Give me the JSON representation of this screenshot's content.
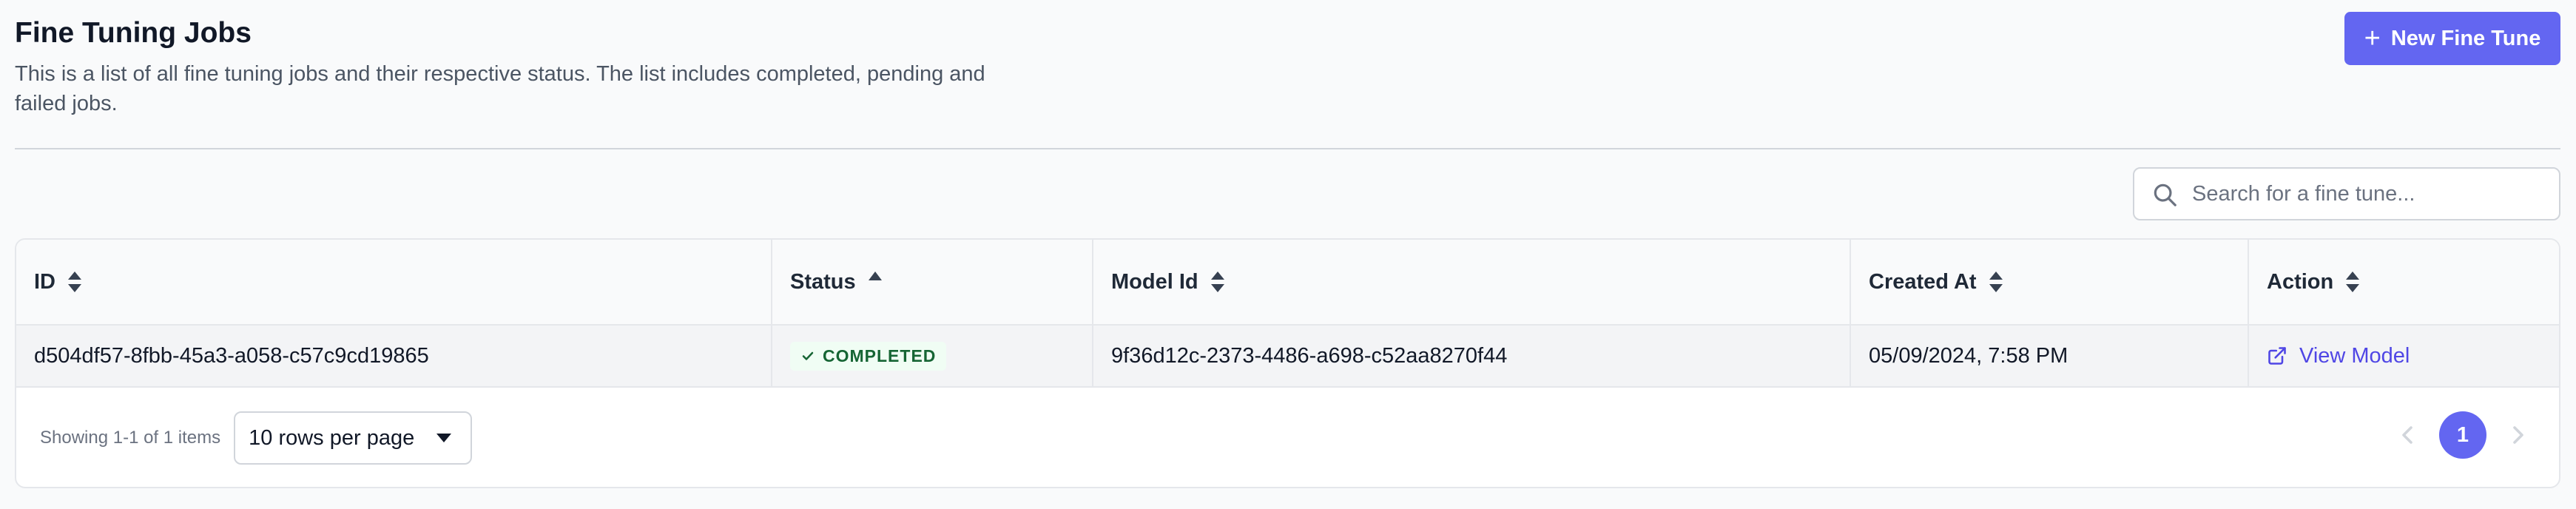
{
  "header": {
    "title": "Fine Tuning Jobs",
    "subtitle": "This is a list of all fine tuning jobs and their respective status. The list includes completed, pending and failed jobs.",
    "new_button_label": "New Fine Tune"
  },
  "search": {
    "placeholder": "Search for a fine tune...",
    "value": ""
  },
  "table": {
    "columns": [
      "ID",
      "Status",
      "Model Id",
      "Created At",
      "Action"
    ],
    "sort": {
      "column": "Status",
      "direction": "ascending"
    },
    "rows": [
      {
        "id": "d504df57-8fbb-45a3-a058-c57c9cd19865",
        "status": "COMPLETED",
        "model_id": "9f36d12c-2373-4486-a698-c52aa8270f44",
        "created_at": "05/09/2024, 7:58 PM",
        "action": "View Model"
      }
    ]
  },
  "footer": {
    "showing": "Showing 1-1 of 1 items",
    "rows_per_page": "10 rows per page",
    "current_page": "1"
  },
  "colors": {
    "accent": "#6366f1",
    "link": "#4f46e5",
    "status_success": "#166534",
    "status_success_bg": "#f0fdf4"
  },
  "icons": {
    "new_button": "plus-icon",
    "search": "search-icon",
    "sort": "sort-icon",
    "status": "check-icon",
    "action": "external-link-icon",
    "select": "caret-down-icon",
    "prev": "chevron-left-icon",
    "next": "chevron-right-icon"
  }
}
